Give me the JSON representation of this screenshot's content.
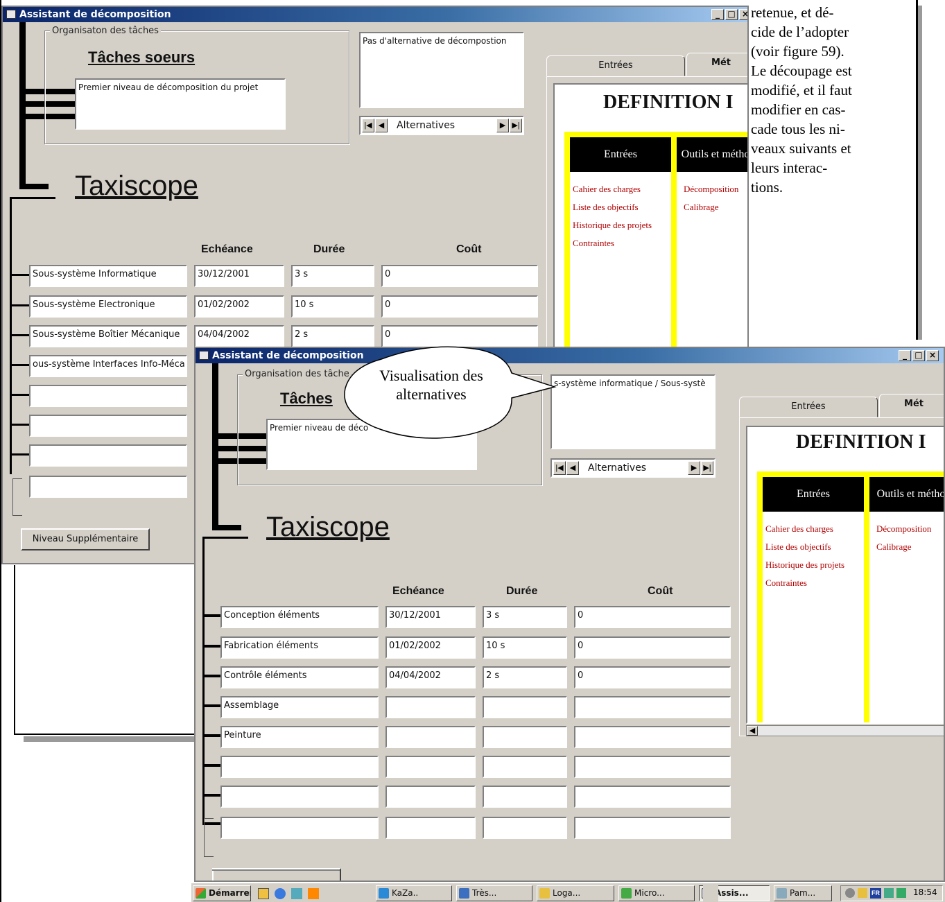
{
  "doc_text": {
    "lines": [
      "retenue, et dé-",
      "cide de l’adopter",
      "(voir figure 59).",
      "Le découpage est",
      "modifié, et il faut",
      "modifier en cas-",
      "cade tous les ni-",
      "veaux suivants et",
      "leurs interac-",
      "tions."
    ]
  },
  "callout": {
    "text": "Visualisation des alternatives"
  },
  "back_window": {
    "title": "Assistant de décomposition",
    "group_label": "Organisaton des tâches",
    "heading": "Tâches soeurs",
    "task_description": "Premier niveau de décomposition du projet",
    "alternative_text": "Pas d'alternative de décompostion",
    "nav_label": "Alternatives",
    "main_title": "Taxiscope",
    "col_echeance": "Echéance",
    "col_duree": "Durée",
    "col_cout": "Coût",
    "rows": [
      {
        "name": "Sous-système Informatique",
        "date": "30/12/2001",
        "duration": "3 s",
        "cost": "0"
      },
      {
        "name": "Sous-système Electronique",
        "date": "01/02/2002",
        "duration": "10 s",
        "cost": "0"
      },
      {
        "name": "Sous-système Boîtier Mécanique",
        "date": "04/04/2002",
        "duration": "2 s",
        "cost": "0"
      },
      {
        "name": "ous-système Interfaces Info-Méca",
        "date": "",
        "duration": "",
        "cost": ""
      }
    ],
    "tab_entrees": "Entrées",
    "tab_methodes": "Mét",
    "def_title": "DEFINITION I",
    "col_entrees": "Entrées",
    "col_outils": "Outils et méthod",
    "entrees_list": [
      "Cahier des charges",
      "Liste des objectifs",
      "Historique des projets",
      "Contraintes"
    ],
    "outils_list": [
      "Décomposition",
      "Calibrage"
    ],
    "extra_button": "Niveau Supplémentaire"
  },
  "front_window": {
    "title": "Assistant de décomposition",
    "group_label": "Organisation des tâche",
    "heading": "Tâches",
    "task_description": "Premier niveau de déco",
    "alternative_text": "s-système informatique / Sous-systè",
    "nav_label": "Alternatives",
    "main_title": "Taxiscope",
    "col_echeance": "Echéance",
    "col_duree": "Durée",
    "col_cout": "Coût",
    "rows": [
      {
        "name": "Conception éléments",
        "date": "30/12/2001",
        "duration": "3 s",
        "cost": "0"
      },
      {
        "name": "Fabrication éléments",
        "date": "01/02/2002",
        "duration": "10 s",
        "cost": "0"
      },
      {
        "name": "Contrôle éléments",
        "date": "04/04/2002",
        "duration": "2 s",
        "cost": "0"
      },
      {
        "name": "Assemblage",
        "date": "",
        "duration": "",
        "cost": ""
      },
      {
        "name": "Peinture",
        "date": "",
        "duration": "",
        "cost": ""
      }
    ],
    "tab_entrees": "Entrées",
    "tab_methodes": "Mét",
    "def_title": "DEFINITION I",
    "col_entrees": "Entrées",
    "col_outils": "Outils et métho",
    "entrees_list": [
      "Cahier des charges",
      "Liste des objectifs",
      "Historique des projets",
      "Contraintes"
    ],
    "outils_list": [
      "Décomposition",
      "Calibrage"
    ]
  },
  "taskbar": {
    "start": "Démarrer",
    "buttons": [
      "KaZa..",
      "Très...",
      "Loga...",
      "Micro...",
      "Assis...",
      "Pam..."
    ],
    "clock": "18:54",
    "lang": "FR"
  },
  "colors": {
    "title_blue": "#0a246a",
    "face": "#d4d0c8",
    "yellow": "#ffff00",
    "red_text": "#b00000"
  }
}
